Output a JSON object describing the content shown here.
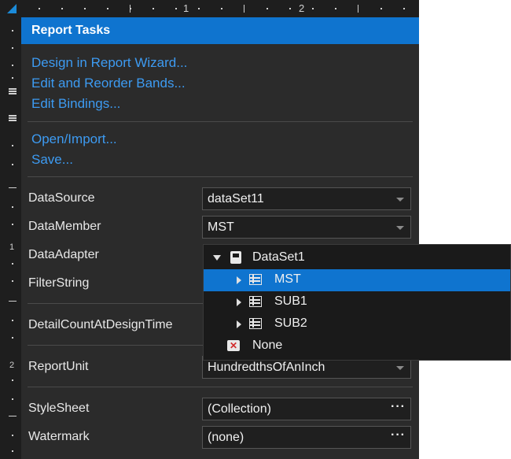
{
  "ruler": {
    "h_numbers": [
      "1",
      "2"
    ],
    "v_numbers": [
      "1",
      "2"
    ]
  },
  "header": {
    "title": "Report Tasks"
  },
  "actions": {
    "group1": [
      "Design in Report Wizard...",
      "Edit and Reorder Bands...",
      "Edit Bindings..."
    ],
    "group2": [
      "Open/Import...",
      "Save..."
    ]
  },
  "properties": {
    "datasource": {
      "label": "DataSource",
      "value": "dataSet11"
    },
    "datamember": {
      "label": "DataMember",
      "value": "MST"
    },
    "dataadapter": {
      "label": "DataAdapter"
    },
    "filterstring": {
      "label": "FilterString"
    },
    "detailcount": {
      "label": "DetailCountAtDesignTime"
    },
    "reportunit": {
      "label": "ReportUnit",
      "value": "HundredthsOfAnInch"
    },
    "stylesheet": {
      "label": "StyleSheet",
      "value": "(Collection)",
      "button": "···"
    },
    "watermark": {
      "label": "Watermark",
      "value": "(none)",
      "button": "···"
    }
  },
  "dropdown": {
    "root": "DataSet1",
    "items": [
      "MST",
      "SUB1",
      "SUB2"
    ],
    "selected": "MST",
    "none_label": "None"
  },
  "colors": {
    "accent": "#0f74cf",
    "link": "#3d9bf2",
    "panel": "#2b2b2b"
  }
}
